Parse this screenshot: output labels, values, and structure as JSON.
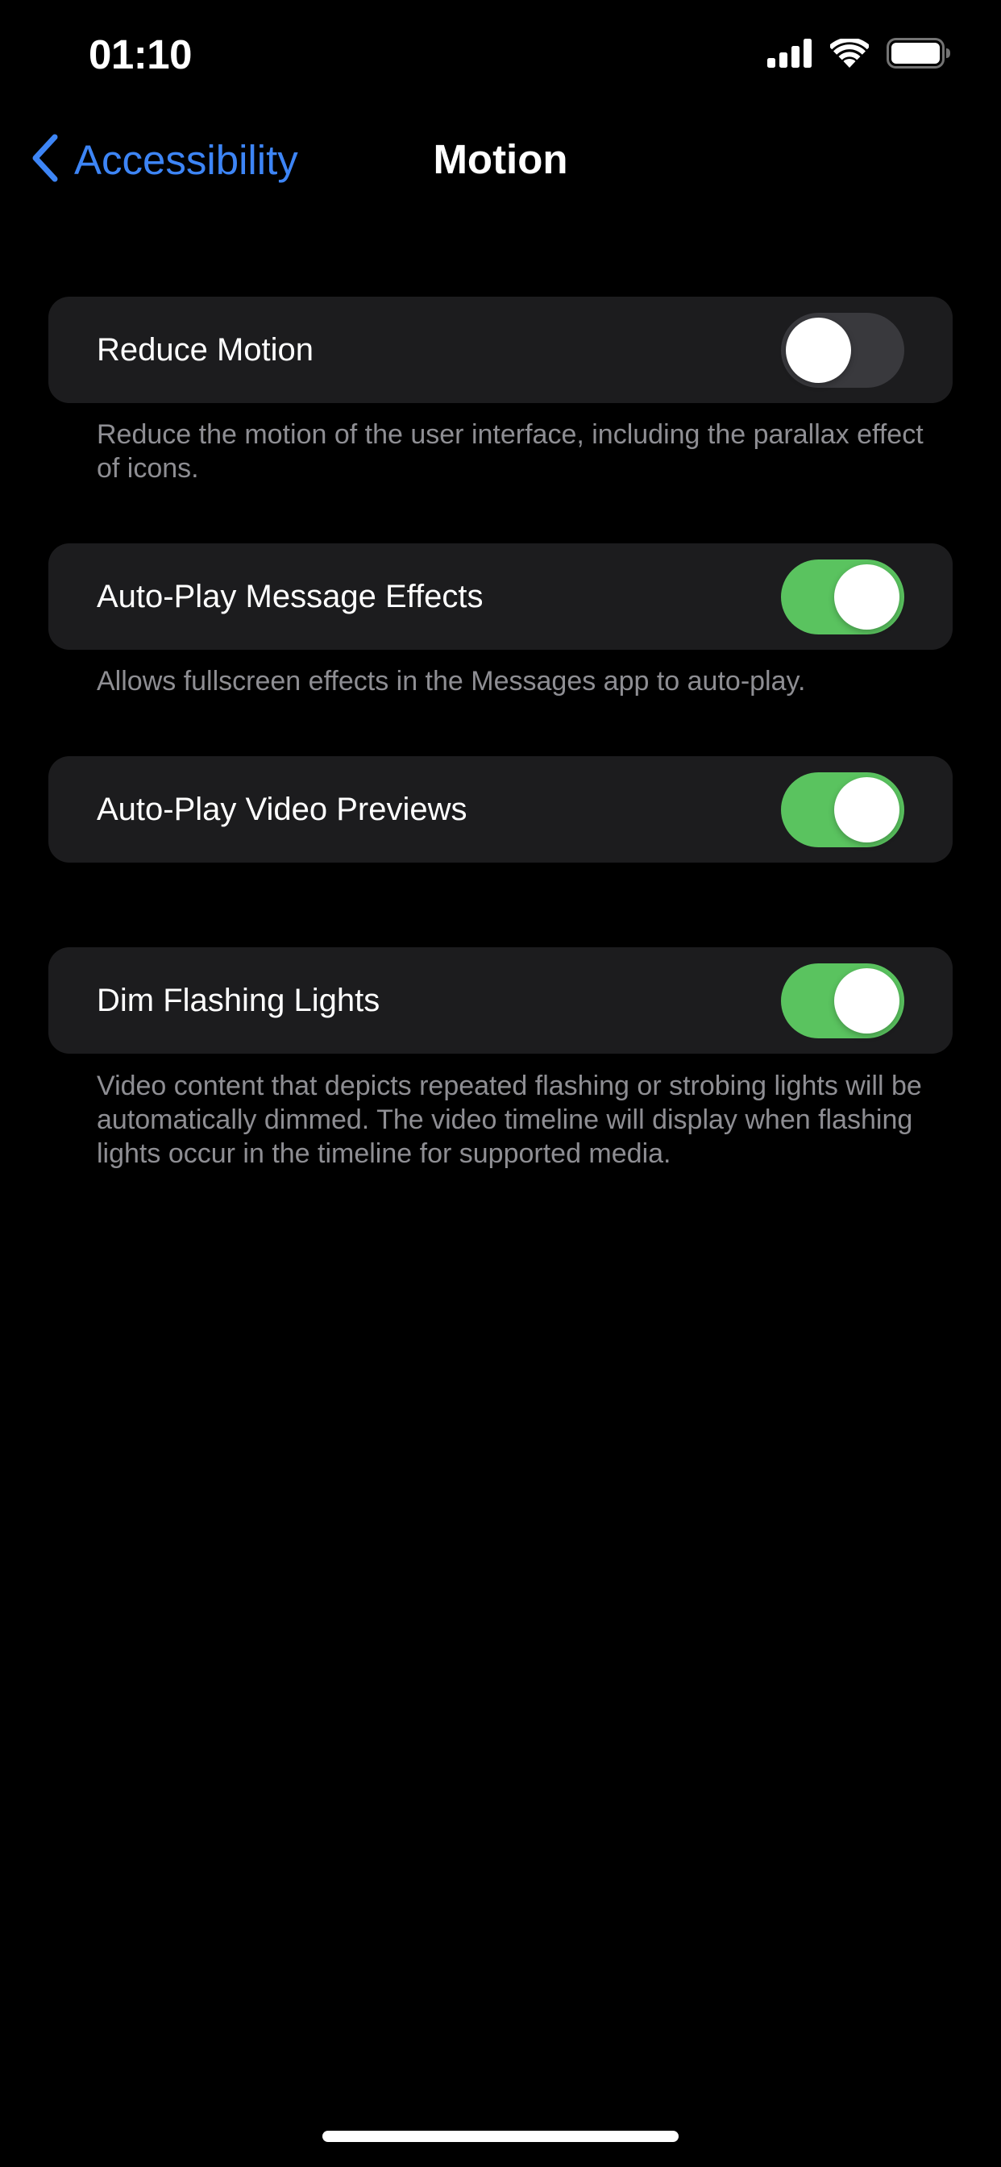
{
  "status_bar": {
    "time": "01:10",
    "icons": [
      "cellular-signal-icon",
      "wifi-icon",
      "battery-icon"
    ]
  },
  "nav": {
    "back_label": "Accessibility",
    "title": "Motion"
  },
  "settings": {
    "reduce_motion": {
      "label": "Reduce Motion",
      "enabled": false,
      "footer": "Reduce the motion of the user interface, including the parallax effect of icons."
    },
    "auto_play_message_effects": {
      "label": "Auto-Play Message Effects",
      "enabled": true,
      "footer": "Allows fullscreen effects in the Messages app to auto-play."
    },
    "auto_play_video_previews": {
      "label": "Auto-Play Video Previews",
      "enabled": true
    },
    "dim_flashing_lights": {
      "label": "Dim Flashing Lights",
      "enabled": true,
      "footer": "Video content that depicts repeated flashing or strobing lights will be automatically dimmed. The video timeline will display when flashing lights occur in the timeline for supported media."
    }
  },
  "colors": {
    "accent": "#3d85f6",
    "toggle_on": "#5ac35f",
    "toggle_off": "#39393d",
    "cell_background": "#1c1c1e",
    "secondary_text": "#8e8e93",
    "background": "#000000"
  }
}
